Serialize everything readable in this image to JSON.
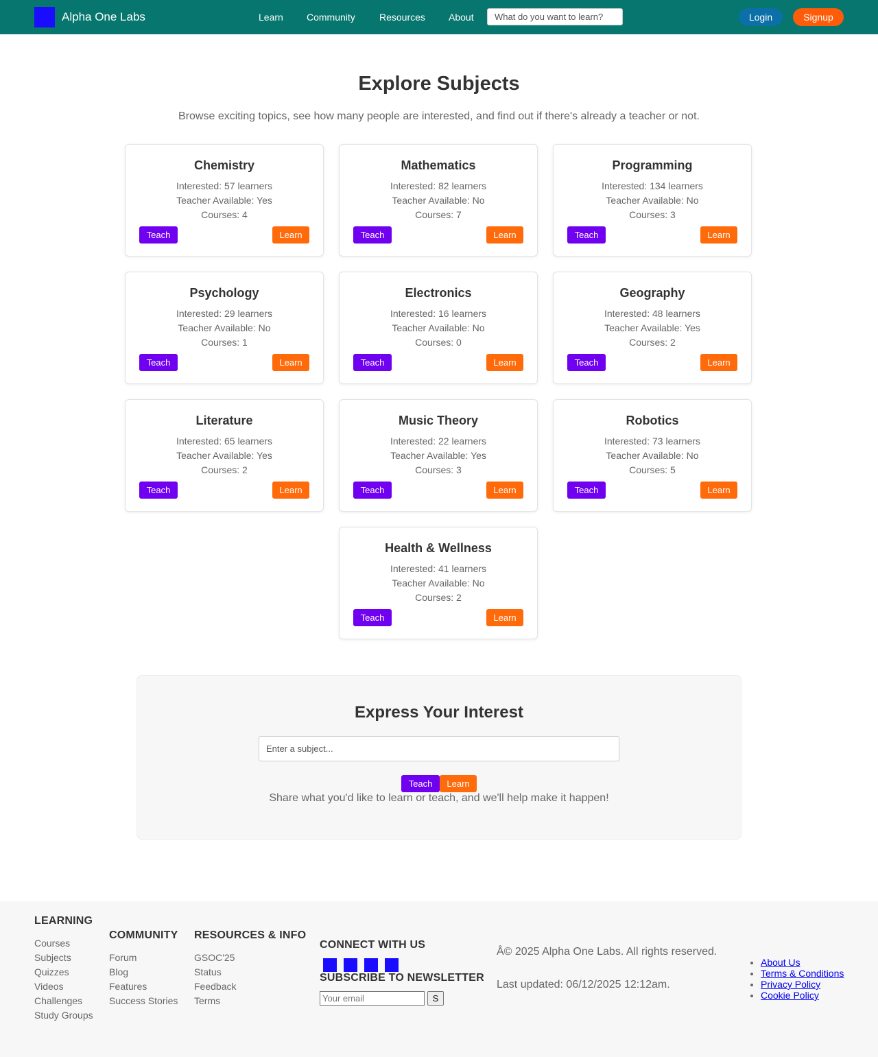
{
  "header": {
    "brand": "Alpha One Labs",
    "nav": [
      "Learn",
      "Community",
      "Resources",
      "About"
    ],
    "search_placeholder": "What do you want to learn?",
    "login": "Login",
    "signup": "Signup"
  },
  "page": {
    "title": "Explore Subjects",
    "subtitle": "Browse exciting topics, see how many people are interested, and find out if there's already a teacher or not."
  },
  "subjects": [
    {
      "name": "Chemistry",
      "interested": "Interested: 57 learners",
      "teacher": "Teacher Available: Yes",
      "courses": "Courses: 4"
    },
    {
      "name": "Mathematics",
      "interested": "Interested: 82 learners",
      "teacher": "Teacher Available: No",
      "courses": "Courses: 7"
    },
    {
      "name": "Programming",
      "interested": "Interested: 134 learners",
      "teacher": "Teacher Available: No",
      "courses": "Courses: 3"
    },
    {
      "name": "Psychology",
      "interested": "Interested: 29 learners",
      "teacher": "Teacher Available: No",
      "courses": "Courses: 1"
    },
    {
      "name": "Electronics",
      "interested": "Interested: 16 learners",
      "teacher": "Teacher Available: No",
      "courses": "Courses: 0"
    },
    {
      "name": "Geography",
      "interested": "Interested: 48 learners",
      "teacher": "Teacher Available: Yes",
      "courses": "Courses: 2"
    },
    {
      "name": "Literature",
      "interested": "Interested: 65 learners",
      "teacher": "Teacher Available: Yes",
      "courses": "Courses: 2"
    },
    {
      "name": "Music Theory",
      "interested": "Interested: 22 learners",
      "teacher": "Teacher Available: Yes",
      "courses": "Courses: 3"
    },
    {
      "name": "Robotics",
      "interested": "Interested: 73 learners",
      "teacher": "Teacher Available: No",
      "courses": "Courses: 5"
    },
    {
      "name": "Health & Wellness",
      "interested": "Interested: 41 learners",
      "teacher": "Teacher Available: No",
      "courses": "Courses: 2"
    }
  ],
  "card_buttons": {
    "teach": "Teach",
    "learn": "Learn"
  },
  "interest": {
    "title": "Express Your Interest",
    "placeholder": "Enter a subject...",
    "teach": "Teach",
    "learn": "Learn",
    "message": "Share what you'd like to learn or teach, and we'll help make it happen!"
  },
  "footer": {
    "learning": {
      "heading": "LEARNING",
      "links": [
        "Courses",
        "Subjects",
        "Quizzes",
        "Videos",
        "Challenges",
        "Study Groups"
      ]
    },
    "community": {
      "heading": "COMMUNITY",
      "links": [
        "Forum",
        "Blog",
        "Features",
        "Success Stories"
      ]
    },
    "resources": {
      "heading": "RESOURCES & INFO",
      "links": [
        "GSOC'25",
        "Status",
        "Feedback",
        "Terms"
      ]
    },
    "connect": "CONNECT WITH US",
    "newsletter": "SUBSCRIBE TO NEWSLETTER",
    "email_placeholder": "Your email",
    "subscribe_btn": "S",
    "copyright": "Â© 2025 Alpha One Labs. All rights reserved.",
    "updated": "Last updated: 06/12/2025 12:12am.",
    "legal": [
      "About Us",
      "Terms & Conditions",
      "Privacy Policy",
      "Cookie Policy"
    ]
  }
}
